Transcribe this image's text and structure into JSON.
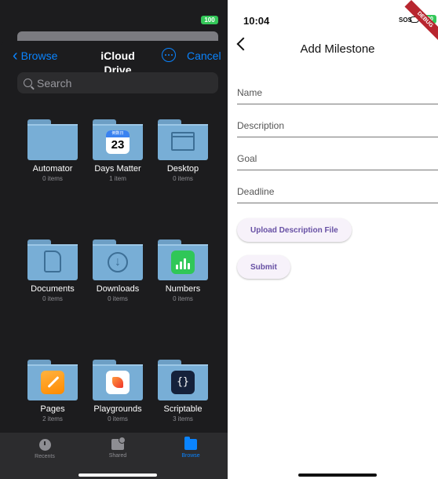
{
  "left": {
    "status": {
      "battery": "100"
    },
    "nav": {
      "back_label": "Browse",
      "title": "iCloud Drive",
      "cancel_label": "Cancel"
    },
    "search": {
      "placeholder": "Search"
    },
    "items": [
      {
        "name": "Automator",
        "count": "0 items",
        "badge": "none"
      },
      {
        "name": "Days Matter",
        "count": "1 item",
        "badge": "calendar",
        "badge_day": "23",
        "badge_header": "倒数日"
      },
      {
        "name": "Desktop",
        "count": "0 items",
        "badge": "desktop"
      },
      {
        "name": "Documents",
        "count": "0 items",
        "badge": "document"
      },
      {
        "name": "Downloads",
        "count": "0 items",
        "badge": "download"
      },
      {
        "name": "Numbers",
        "count": "0 items",
        "badge": "numbers"
      },
      {
        "name": "Pages",
        "count": "2 items",
        "badge": "pages"
      },
      {
        "name": "Playgrounds",
        "count": "0 items",
        "badge": "swift"
      },
      {
        "name": "Scriptable",
        "count": "3 items",
        "badge": "scriptable",
        "badge_text": "{}"
      }
    ],
    "tabbar": {
      "recents": "Recents",
      "shared": "Shared",
      "browse": "Browse"
    },
    "colors": {
      "accent": "#0a84ff",
      "background": "#1c1c1e",
      "folder": "#78aed6"
    }
  },
  "right": {
    "status": {
      "time": "10:04",
      "sos": "SOS",
      "battery": "100",
      "ribbon": "DEBUG"
    },
    "title": "Add Milestone",
    "fields": {
      "name": {
        "placeholder": "Name",
        "value": ""
      },
      "description": {
        "placeholder": "Description",
        "value": ""
      },
      "goal": {
        "placeholder": "Goal",
        "value": ""
      },
      "deadline": {
        "placeholder": "Deadline",
        "value": ""
      }
    },
    "buttons": {
      "upload": "Upload Description File",
      "submit": "Submit"
    },
    "colors": {
      "button_text": "#6750a4",
      "button_bg": "#f7f2fa"
    }
  }
}
